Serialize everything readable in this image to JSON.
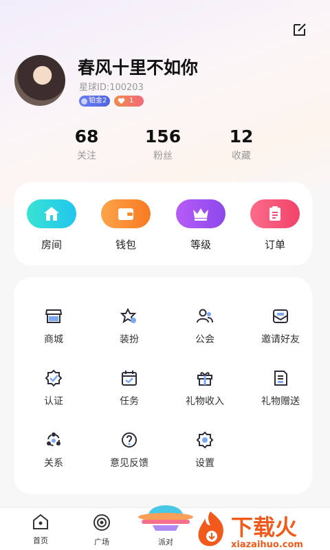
{
  "profile": {
    "name": "春风十里不如你",
    "id": "星球ID:100203",
    "level_badge": "铂金2",
    "heart_count": "1"
  },
  "stats": [
    {
      "num": "68",
      "label": "关注"
    },
    {
      "num": "156",
      "label": "粉丝"
    },
    {
      "num": "12",
      "label": "收藏"
    }
  ],
  "quick": [
    {
      "label": "房间",
      "icon": "home-icon",
      "color": "#2cd4e0"
    },
    {
      "label": "钱包",
      "icon": "wallet-icon",
      "color": "#fb8c2e"
    },
    {
      "label": "等级",
      "icon": "crown-icon",
      "color": "#9d52f0"
    },
    {
      "label": "订单",
      "icon": "order-icon",
      "color": "#f54d75"
    }
  ],
  "menu": [
    {
      "label": "商城",
      "icon": "store-icon"
    },
    {
      "label": "装扮",
      "icon": "dress-up-icon"
    },
    {
      "label": "公会",
      "icon": "guild-icon"
    },
    {
      "label": "邀请好友",
      "icon": "invite-icon"
    },
    {
      "label": "认证",
      "icon": "verify-icon"
    },
    {
      "label": "任务",
      "icon": "task-icon"
    },
    {
      "label": "礼物收入",
      "icon": "gift-icon"
    },
    {
      "label": "礼物赠送",
      "icon": "gift-send-icon"
    },
    {
      "label": "关系",
      "icon": "relation-icon"
    },
    {
      "label": "意见反馈",
      "icon": "feedback-icon"
    },
    {
      "label": "设置",
      "icon": "settings-icon"
    }
  ],
  "tabs": {
    "home": "首页",
    "square": "广场",
    "party": "派对"
  },
  "watermark": {
    "title": "下载火",
    "url": "xiazaihuo.com"
  }
}
